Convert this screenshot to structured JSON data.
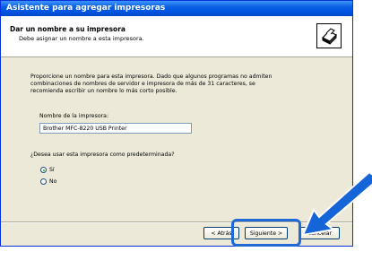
{
  "window": {
    "title": "Asistente para agregar impresoras"
  },
  "header": {
    "title": "Dar un nombre a su impresora",
    "subtitle": "Debe asignar un nombre a esta impresora.",
    "icon": "printer-icon"
  },
  "content": {
    "intro_line1": "Proporcione un nombre para esta impresora. Dado que algunos programas no admiten",
    "intro_line2": "combinaciones de nombres de servidor e impresora de más de 31 caracteres, se",
    "intro_line3": "recomienda escribir un nombre lo más corto posible.",
    "name_label": "Nombre de la impresora:",
    "name_value": "Brother MFC-8220 USB Printer",
    "default_question": "¿Desea usar esta impresora como predeterminada?",
    "options": [
      {
        "label": "Sí",
        "selected": true
      },
      {
        "label": "No",
        "selected": false
      }
    ]
  },
  "buttons": {
    "back": "< Atrás",
    "next": "Siguiente >",
    "cancel": "Cancelar"
  },
  "colors": {
    "highlight": "#1f6ad6",
    "arrow": "#1565d8"
  }
}
